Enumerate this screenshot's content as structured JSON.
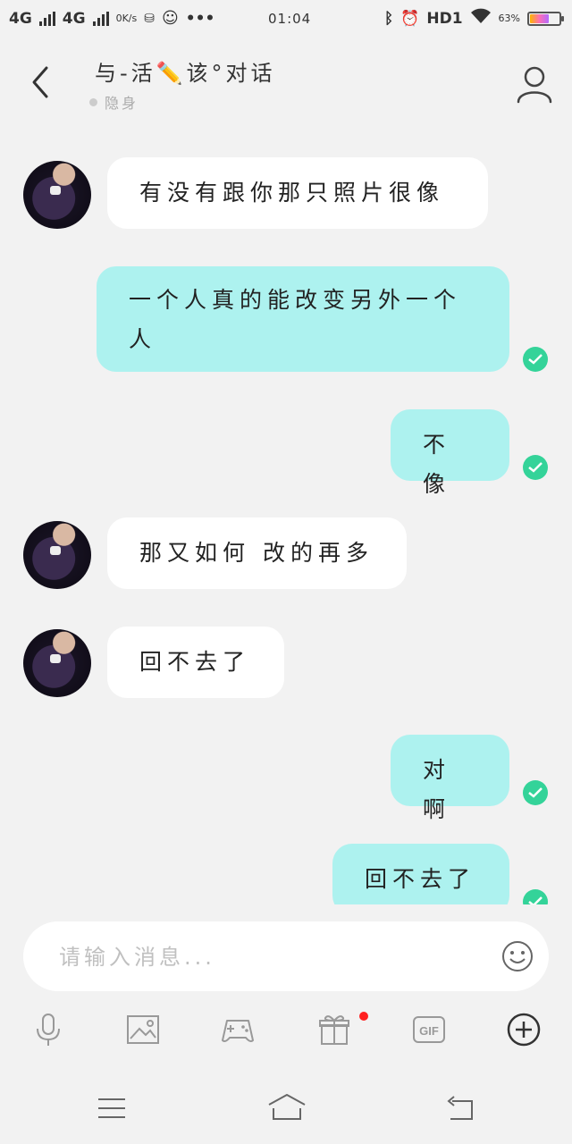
{
  "status_bar": {
    "left": [
      "4G",
      "4G",
      "0K/s"
    ],
    "time": "01:04",
    "hd": "HD1",
    "battery": "63%"
  },
  "header": {
    "back_icon": "chevron-left-icon",
    "title": "与-活✏️该°对话",
    "status": "隐身",
    "profile_icon": "person-icon"
  },
  "messages": [
    {
      "side": "in",
      "text": "有没有跟你那只照片很像"
    },
    {
      "side": "out",
      "text": "一个人真的能改变另外一个人",
      "read": true
    },
    {
      "side": "out",
      "text": "不像",
      "read": true
    },
    {
      "side": "in",
      "text": "那又如何 改的再多"
    },
    {
      "side": "in",
      "text": "回不去了"
    },
    {
      "side": "out",
      "text": "对啊",
      "read": true
    },
    {
      "side": "out",
      "text": "回不去了",
      "read": true
    }
  ],
  "input": {
    "placeholder": "请输入消息...",
    "emoji_icon": "smiley-icon"
  },
  "toolbar": {
    "icons": [
      "microphone-icon",
      "image-icon",
      "gamepad-icon",
      "gift-icon",
      "gif-icon",
      "plus-circle-icon"
    ],
    "gif_label": "GIF"
  },
  "nav": {
    "icons": [
      "menu-icon",
      "home-icon",
      "back-icon"
    ]
  },
  "colors": {
    "outgoing_bubble": "#adf2ef",
    "incoming_bubble": "#ffffff",
    "read_check": "#34d399",
    "background": "#f2f2f2"
  }
}
